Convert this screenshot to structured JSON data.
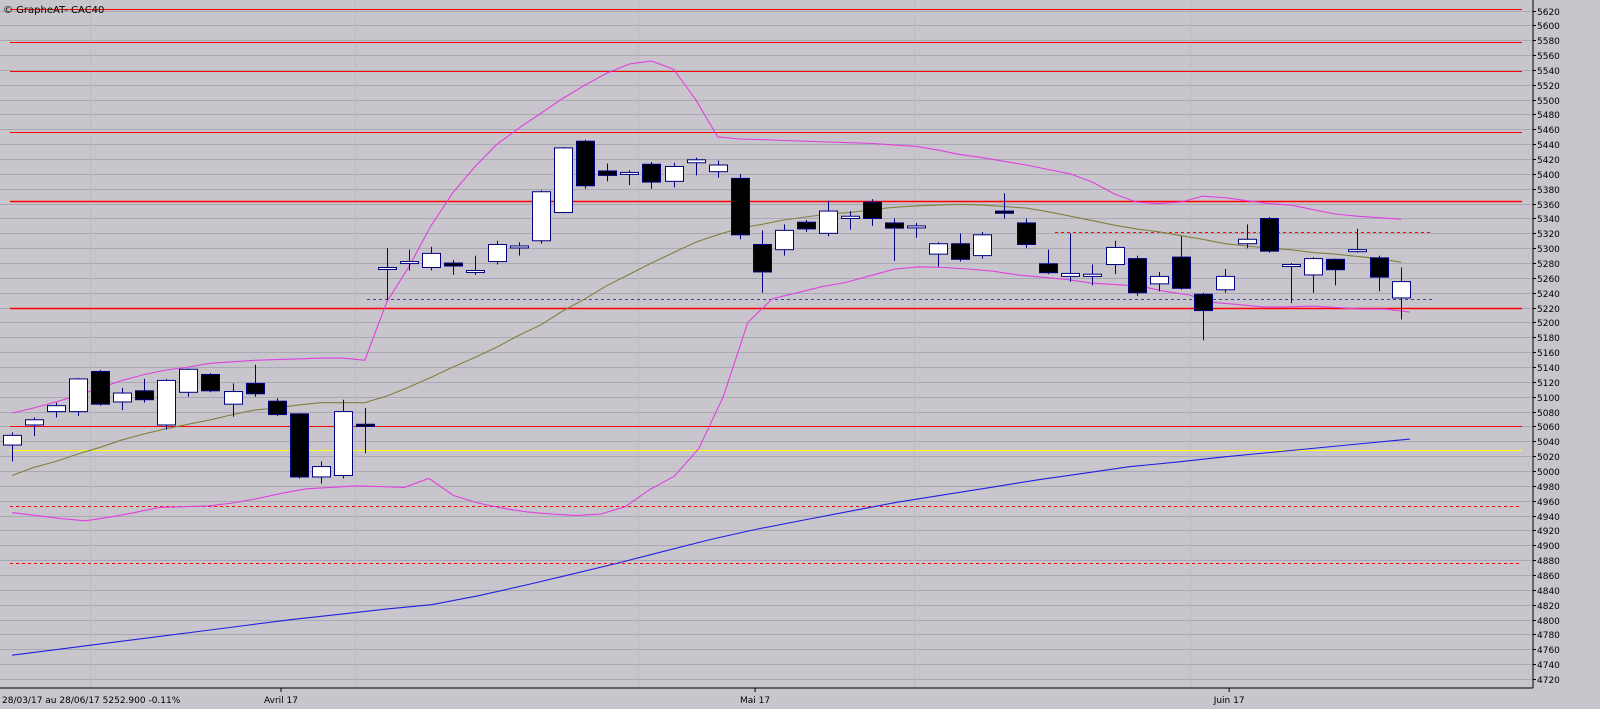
{
  "chart_data": {
    "type": "candlestick",
    "title": "© GrapheAT- CAC40",
    "footer": "28/03/17 au 28/06/17  5252.900  -0.11%",
    "ylim": [
      4710,
      5630
    ],
    "y_ticks": [
      4720,
      4740,
      4760,
      4780,
      4800,
      4820,
      4840,
      4860,
      4880,
      4900,
      4920,
      4940,
      4960,
      4980,
      5000,
      5020,
      5040,
      5060,
      5080,
      5100,
      5120,
      5140,
      5160,
      5180,
      5200,
      5220,
      5240,
      5260,
      5280,
      5300,
      5320,
      5340,
      5360,
      5380,
      5400,
      5420,
      5440,
      5460,
      5480,
      5500,
      5520,
      5540,
      5560,
      5580,
      5600,
      5620
    ],
    "month_labels": [
      {
        "label": "Avril 17",
        "index": 12.2
      },
      {
        "label": "Mai 17",
        "index": 33.7
      },
      {
        "label": "Juin 17",
        "index": 55.2
      }
    ],
    "candles": [
      {
        "o": 5035,
        "h": 5052,
        "l": 5013,
        "c": 5048
      },
      {
        "o": 5062,
        "h": 5072,
        "l": 5047,
        "c": 5069
      },
      {
        "o": 5080,
        "h": 5092,
        "l": 5072,
        "c": 5088
      },
      {
        "o": 5080,
        "h": 5125,
        "l": 5074,
        "c": 5124
      },
      {
        "o": 5134,
        "h": 5136,
        "l": 5088,
        "c": 5090
      },
      {
        "o": 5093,
        "h": 5112,
        "l": 5082,
        "c": 5105
      },
      {
        "o": 5108,
        "h": 5124,
        "l": 5092,
        "c": 5096
      },
      {
        "o": 5062,
        "h": 5124,
        "l": 5056,
        "c": 5122
      },
      {
        "o": 5106,
        "h": 5138,
        "l": 5100,
        "c": 5137
      },
      {
        "o": 5130,
        "h": 5132,
        "l": 5106,
        "c": 5108
      },
      {
        "o": 5090,
        "h": 5118,
        "l": 5073,
        "c": 5107
      },
      {
        "o": 5118,
        "h": 5143,
        "l": 5100,
        "c": 5104
      },
      {
        "o": 5094,
        "h": 5098,
        "l": 5074,
        "c": 5076
      },
      {
        "o": 5077,
        "h": 5078,
        "l": 4990,
        "c": 4992
      },
      {
        "o": 4992,
        "h": 5013,
        "l": 4983,
        "c": 5006
      },
      {
        "o": 4994,
        "h": 5096,
        "l": 4990,
        "c": 5080
      },
      {
        "o": 5063,
        "h": 5085,
        "l": 5024,
        "c": 5060
      },
      {
        "o": 5274,
        "h": 5300,
        "l": 5230,
        "c": 5274
      },
      {
        "o": 5280,
        "h": 5298,
        "l": 5270,
        "c": 5282
      },
      {
        "o": 5274,
        "h": 5302,
        "l": 5270,
        "c": 5293
      },
      {
        "o": 5280,
        "h": 5284,
        "l": 5264,
        "c": 5276
      },
      {
        "o": 5270,
        "h": 5290,
        "l": 5264,
        "c": 5270
      },
      {
        "o": 5282,
        "h": 5310,
        "l": 5278,
        "c": 5305
      },
      {
        "o": 5303,
        "h": 5308,
        "l": 5290,
        "c": 5303
      },
      {
        "o": 5310,
        "h": 5378,
        "l": 5306,
        "c": 5376
      },
      {
        "o": 5348,
        "h": 5436,
        "l": 5347,
        "c": 5435
      },
      {
        "o": 5444,
        "h": 5446,
        "l": 5380,
        "c": 5384
      },
      {
        "o": 5404,
        "h": 5414,
        "l": 5390,
        "c": 5398
      },
      {
        "o": 5400,
        "h": 5405,
        "l": 5385,
        "c": 5402
      },
      {
        "o": 5413,
        "h": 5416,
        "l": 5380,
        "c": 5389
      },
      {
        "o": 5390,
        "h": 5415,
        "l": 5382,
        "c": 5410
      },
      {
        "o": 5415,
        "h": 5422,
        "l": 5398,
        "c": 5419
      },
      {
        "o": 5403,
        "h": 5418,
        "l": 5395,
        "c": 5412
      },
      {
        "o": 5394,
        "h": 5400,
        "l": 5312,
        "c": 5318
      },
      {
        "o": 5305,
        "h": 5324,
        "l": 5240,
        "c": 5268
      },
      {
        "o": 5298,
        "h": 5332,
        "l": 5290,
        "c": 5324
      },
      {
        "o": 5335,
        "h": 5338,
        "l": 5322,
        "c": 5326
      },
      {
        "o": 5320,
        "h": 5364,
        "l": 5316,
        "c": 5350
      },
      {
        "o": 5340,
        "h": 5350,
        "l": 5325,
        "c": 5343
      },
      {
        "o": 5362,
        "h": 5366,
        "l": 5330,
        "c": 5340
      },
      {
        "o": 5334,
        "h": 5340,
        "l": 5283,
        "c": 5327
      },
      {
        "o": 5328,
        "h": 5334,
        "l": 5314,
        "c": 5330
      },
      {
        "o": 5292,
        "h": 5308,
        "l": 5275,
        "c": 5306
      },
      {
        "o": 5306,
        "h": 5320,
        "l": 5282,
        "c": 5285
      },
      {
        "o": 5290,
        "h": 5322,
        "l": 5286,
        "c": 5318
      },
      {
        "o": 5350,
        "h": 5374,
        "l": 5340,
        "c": 5347
      },
      {
        "o": 5334,
        "h": 5340,
        "l": 5300,
        "c": 5305
      },
      {
        "o": 5279,
        "h": 5298,
        "l": 5265,
        "c": 5267
      },
      {
        "o": 5262,
        "h": 5320,
        "l": 5255,
        "c": 5266
      },
      {
        "o": 5262,
        "h": 5278,
        "l": 5250,
        "c": 5265
      },
      {
        "o": 5278,
        "h": 5310,
        "l": 5265,
        "c": 5301
      },
      {
        "o": 5286,
        "h": 5290,
        "l": 5236,
        "c": 5240
      },
      {
        "o": 5252,
        "h": 5268,
        "l": 5242,
        "c": 5262
      },
      {
        "o": 5288,
        "h": 5316,
        "l": 5244,
        "c": 5246
      },
      {
        "o": 5238,
        "h": 5240,
        "l": 5176,
        "c": 5216
      },
      {
        "o": 5244,
        "h": 5272,
        "l": 5240,
        "c": 5262
      },
      {
        "o": 5306,
        "h": 5332,
        "l": 5300,
        "c": 5312
      },
      {
        "o": 5340,
        "h": 5342,
        "l": 5294,
        "c": 5296
      },
      {
        "o": 5276,
        "h": 5280,
        "l": 5226,
        "c": 5278
      },
      {
        "o": 5264,
        "h": 5288,
        "l": 5240,
        "c": 5286
      },
      {
        "o": 5285,
        "h": 5286,
        "l": 5250,
        "c": 5271
      },
      {
        "o": 5298,
        "h": 5326,
        "l": 5294,
        "c": 5298
      },
      {
        "o": 5287,
        "h": 5290,
        "l": 5242,
        "c": 5261
      },
      {
        "o": 5233,
        "h": 5274,
        "l": 5204,
        "c": 5255
      }
    ],
    "series": [
      {
        "color": "#808040",
        "values": [
          4994,
          5005,
          5013,
          5023,
          5032,
          5042,
          5050,
          5057,
          5063,
          5069,
          5076,
          5082,
          5085,
          5089,
          5092,
          5092,
          5092,
          5101,
          5113,
          5126,
          5140,
          5153,
          5167,
          5183,
          5197,
          5216,
          5232,
          5250,
          5265,
          5280,
          5294,
          5308,
          5318,
          5327,
          5332,
          5338,
          5342,
          5346,
          5348,
          5352,
          5355,
          5357,
          5358,
          5359,
          5358,
          5356,
          5354,
          5349,
          5343,
          5337,
          5331,
          5326,
          5322,
          5317,
          5312,
          5306,
          5303,
          5300,
          5298,
          5294,
          5292,
          5289,
          5286,
          5281
        ]
      },
      {
        "color": "#e040e0",
        "values": [
          5078,
          5085,
          5093,
          5102,
          5112,
          5122,
          5130,
          5136,
          5140,
          5145,
          5147,
          5149,
          5150,
          5151,
          5152,
          5152,
          5149,
          5228,
          5275,
          5330,
          5375,
          5410,
          5440,
          5462,
          5482,
          5502,
          5520,
          5536,
          5548,
          5552,
          5541,
          5500,
          5450,
          5447,
          5446,
          5445,
          5444,
          5443,
          5442,
          5441,
          5439,
          5437,
          5432,
          5426,
          5422,
          5417,
          5412,
          5406,
          5400,
          5389,
          5373,
          5362,
          5360,
          5362,
          5370,
          5368,
          5364,
          5360,
          5358,
          5352,
          5346,
          5343,
          5341,
          5339
        ]
      },
      {
        "color": "#e040e0",
        "values": [
          4944,
          4940,
          4936,
          4933,
          4938,
          4944,
          4951,
          4952,
          4953,
          4957,
          4963,
          4970,
          4976,
          4978,
          4980,
          4979,
          4978,
          4990,
          4967,
          4957,
          4950,
          4945,
          4942,
          4940,
          4942,
          4952,
          4975,
          4993,
          5030,
          5100,
          5200,
          5232,
          5240,
          5248,
          5254,
          5263,
          5272,
          5275,
          5274,
          5272,
          5269,
          5264,
          5261,
          5258,
          5253,
          5251,
          5249,
          5242,
          5237,
          5227,
          5224,
          5221,
          5221,
          5222,
          5220,
          5218,
          5218,
          5214
        ],
        "start": 0
      },
      {
        "color": "#2020e0",
        "values": [
          4752,
          4760,
          4768,
          4776,
          4784,
          4792,
          4800,
          4807,
          4814,
          4820,
          4832,
          4846,
          4861,
          4876,
          4892,
          4908,
          4922,
          4934,
          4946,
          4958,
          4968,
          4978,
          4988,
          4997,
          5006,
          5012,
          5019,
          5025,
          5031,
          5037,
          5043
        ]
      }
    ],
    "horizontal_lines": [
      {
        "value": 5622,
        "color": "#ff0000",
        "style": "solid"
      },
      {
        "value": 5578,
        "color": "#ff0000",
        "style": "solid"
      },
      {
        "value": 5538,
        "color": "#ff0000",
        "style": "solid"
      },
      {
        "value": 5457,
        "color": "#ff0000",
        "style": "solid"
      },
      {
        "value": 5363,
        "color": "#ff0000",
        "style": "solid"
      },
      {
        "value": 5219,
        "color": "#ff0000",
        "style": "solid"
      },
      {
        "value": 5060,
        "color": "#ff0000",
        "style": "solid"
      },
      {
        "value": 5028,
        "color": "#ffff00",
        "style": "solid"
      },
      {
        "value": 4953,
        "color": "#ff0000",
        "style": "dashed"
      },
      {
        "value": 4876,
        "color": "#ff0000",
        "style": "dashed"
      },
      {
        "value": 5232,
        "color": "#4040a0",
        "style": "dashed"
      },
      {
        "value": 5322,
        "color": "#ff0000",
        "style": "dashed"
      }
    ],
    "colors": {
      "background": "#c8c6cc",
      "grid": "#a9a9b4",
      "up_candle": "#ffffff",
      "down_candle": "#000000",
      "candle_edge": "#000080"
    }
  }
}
